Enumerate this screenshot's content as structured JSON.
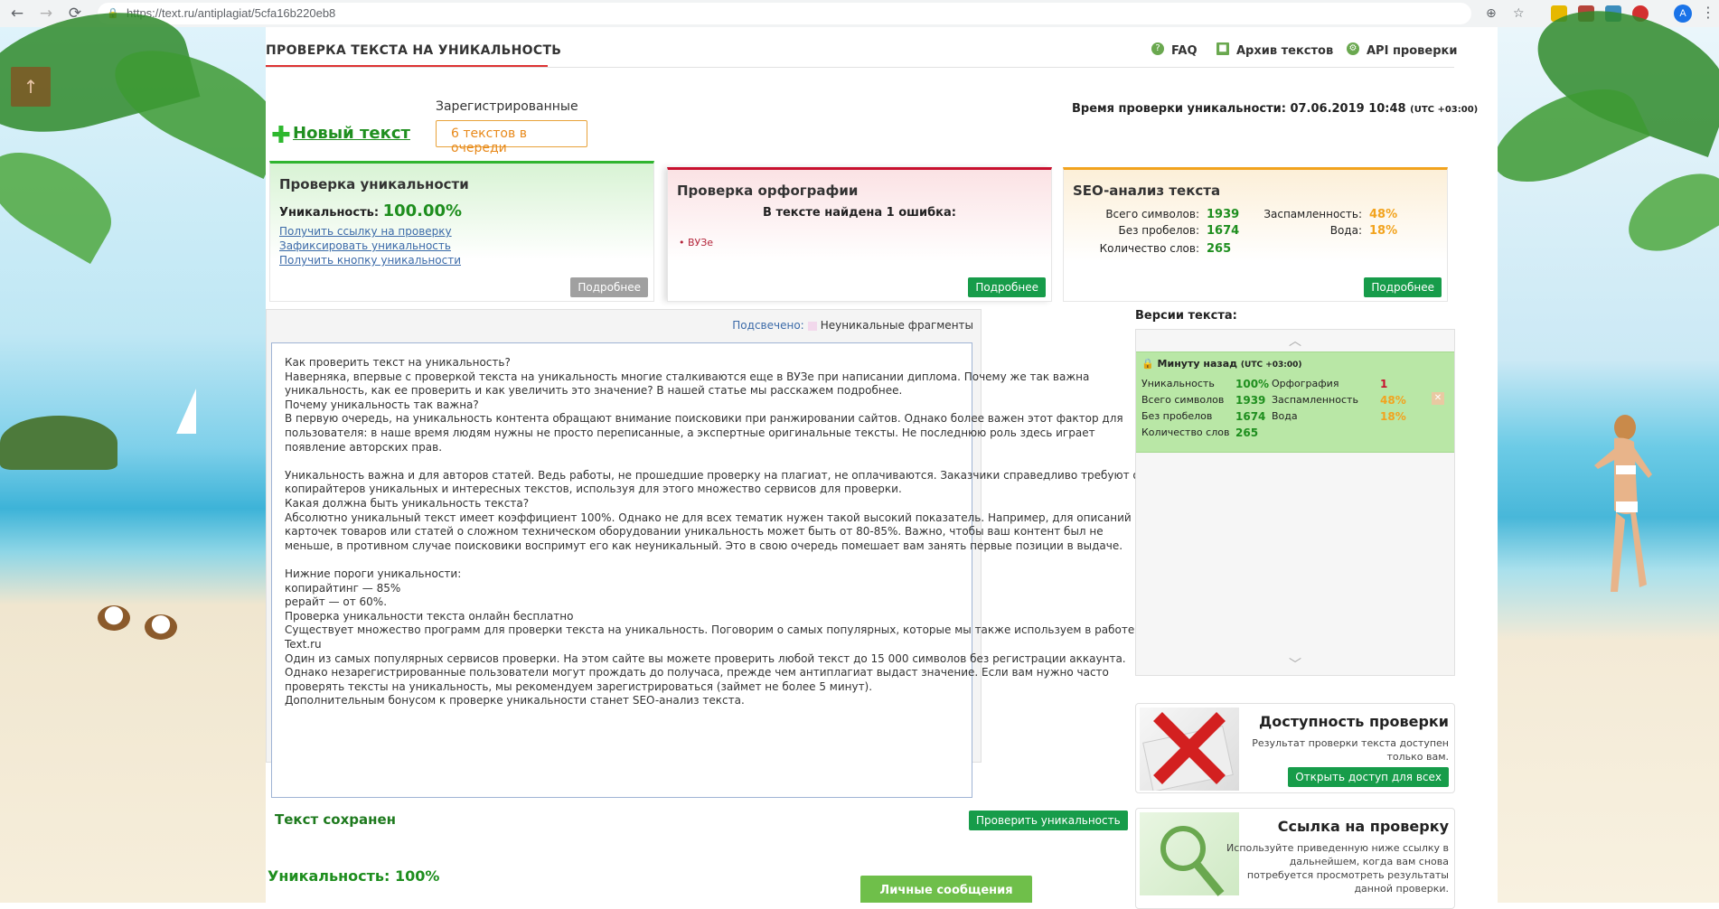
{
  "browser": {
    "url": "https://text.ru/antiplagiat/5cfa16b220eb8",
    "avatar": "A"
  },
  "header": {
    "title": "ПРОВЕРКА ТЕКСТА НА УНИКАЛЬНОСТЬ",
    "faq": "FAQ",
    "archive": "Архив текстов",
    "api": "API проверки",
    "check_time_label": "Время проверки уникальности: 07.06.2019 10:48",
    "check_time_tz": "(UTC +03:00)"
  },
  "queue": {
    "new_text": "Новый текст",
    "registered": "Зарегистрированные",
    "queue_count": "6 текстов в очереди"
  },
  "card_uniq": {
    "title": "Проверка уникальности",
    "label": "Уникальность:",
    "value": "100.00%",
    "link1": "Получить ссылку на проверку",
    "link2": "Зафиксировать уникальность",
    "link3": "Получить кнопку уникальности",
    "more": "Подробнее"
  },
  "card_spell": {
    "title": "Проверка орфографии",
    "found": "В тексте найдена 1 ошибка:",
    "error": "• ВУЗе",
    "more": "Подробнее"
  },
  "card_seo": {
    "title": "SEO-анализ текста",
    "chars_label": "Всего символов:",
    "chars": "1939",
    "nospace_label": "Без пробелов:",
    "nospace": "1674",
    "words_label": "Количество слов:",
    "words": "265",
    "spam_label": "Заспамленность:",
    "spam": "48%",
    "water_label": "Вода:",
    "water": "18%",
    "more": "Подробнее"
  },
  "editor": {
    "highlight_label": "Подсвечено:",
    "highlight_text": "Неуникальные фрагменты",
    "lines": [
      "Как проверить текст на уникальность?",
      "Наверняка, впервые с проверкой текста на уникальность многие сталкиваются еще в ВУЗе при написании диплома. Почему же так важна",
      "уникальность, как ее проверить и как увеличить это значение? В нашей статье мы расскажем подробнее.",
      "Почему уникальность так важна?",
      "В первую очередь, на уникальность контента обращают внимание поисковики при ранжировании сайтов. Однако более важен этот фактор для",
      "пользователя: в наше время людям нужны не просто переписанные, а экспертные оригинальные тексты. Не последнюю роль здесь играет",
      "появление авторских прав.",
      "",
      "Уникальность важна и для авторов статей. Ведь работы, не прошедшие проверку на плагиат, не оплачиваются. Заказчики справедливо требуют от",
      "копирайтеров уникальных и интересных текстов, используя для этого множество сервисов для проверки.",
      "Какая должна быть уникальность текста?",
      "Абсолютно уникальный текст имеет коэффициент 100%. Однако не для всех тематик нужен такой высокий показатель. Например, для описаний",
      "карточек товаров или статей о сложном техническом оборудовании уникальность может быть от 80-85%. Важно, чтобы ваш контент был не",
      "меньше, в противном случае поисковики воспримут его как неуникальный. Это в свою очередь помешает вам занять первые позиции в выдаче.",
      "",
      "Нижние пороги уникальности:",
      "копирайтинг — 85%",
      "рерайт — от 60%.",
      "Проверка уникальности текста онлайн бесплатно",
      "Существует множество программ для проверки текста на уникальность. Поговорим о самых популярных, которые мы также используем в работе.",
      "Text.ru",
      "Один из самых популярных сервисов проверки. На этом сайте вы можете проверить любой текст до 15 000 символов без регистрации аккаунта.",
      "Однако незарегистрированные пользователи могут прождать до получаса, прежде чем антиплагиат выдаст значение. Если вам нужно часто",
      "проверять тексты на уникальность, мы рекомендуем зарегистрироваться (займет не более 5 минут).",
      "Дополнительным бонусом к проверке уникальности станет SEO-анализ текста."
    ],
    "saved": "Текст сохранен",
    "check_button": "Проверить уникальность",
    "uniq_result": "Уникальность: 100%",
    "messages_button": "Личные сообщения"
  },
  "versions": {
    "title": "Версии текста:",
    "time": "Минуту назад",
    "time_tz": "(UTC +03:00)",
    "uniq_label": "Уникальность",
    "uniq": "100%",
    "spell_label": "Орфография",
    "spell": "1",
    "chars_label": "Всего символов",
    "chars": "1939",
    "spam_label": "Заспамленность",
    "spam": "48%",
    "nospace_label": "Без пробелов",
    "nospace": "1674",
    "water_label": "Вода",
    "water": "18%",
    "words_label": "Количество слов",
    "words": "265"
  },
  "promo_access": {
    "title": "Доступность проверки",
    "desc1": "Результат проверки текста доступен",
    "desc2": "только вам.",
    "button": "Открыть доступ для всех"
  },
  "promo_link": {
    "title": "Ссылка на проверку",
    "desc1": "Используйте приведенную ниже ссылку в",
    "desc2": "дальнейшем, когда вам снова",
    "desc3": "потребуется просмотреть результаты",
    "desc4": "данной проверки."
  },
  "colors": {
    "green": "#1e8e1e",
    "red": "#c8102e",
    "orange": "#f2a31e",
    "button_green": "#179c4a"
  }
}
